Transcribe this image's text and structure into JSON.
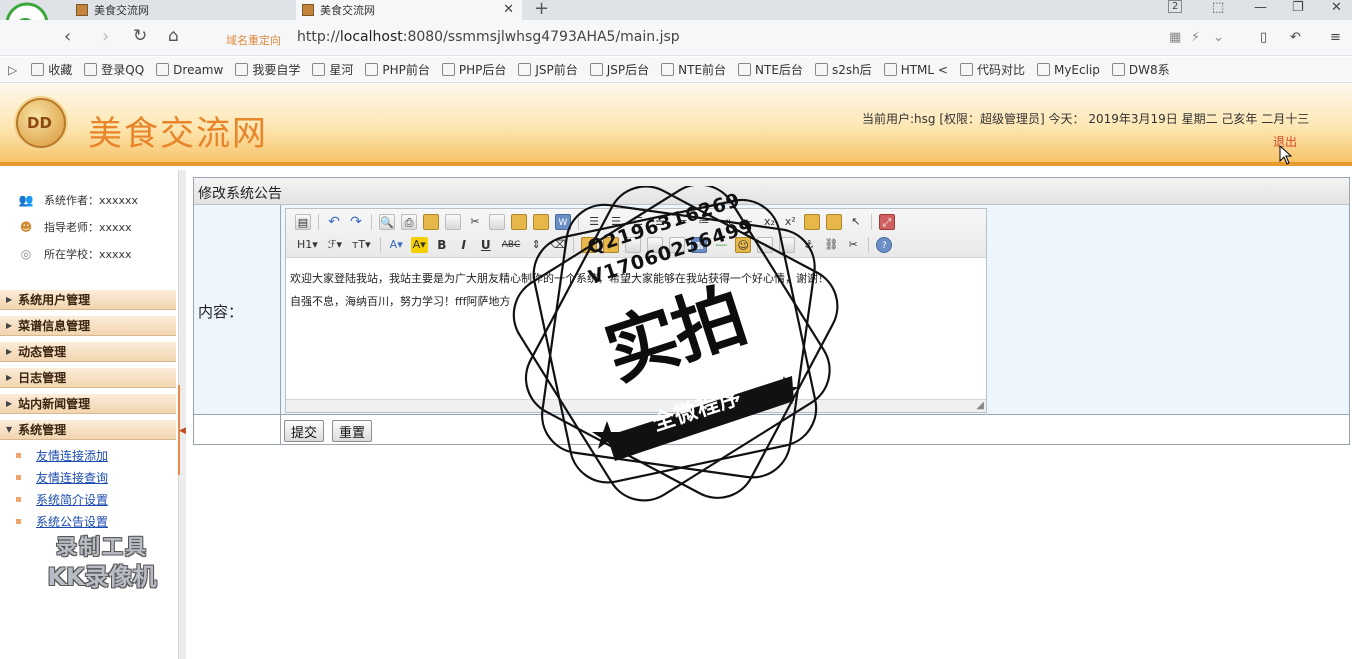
{
  "browser": {
    "tabs": [
      {
        "title": "美食交流网"
      },
      {
        "title": "美食交流网"
      }
    ],
    "tab_count": "2",
    "redirect_label": "域名重定向",
    "url_prefix": "http://",
    "url_host": "localhost",
    "url_rest": ":8080/ssmmsjlwhsg4793AHA5/main.jsp",
    "bookmarks": [
      {
        "label": "收藏",
        "icon": "star-icon"
      },
      {
        "label": "登录QQ",
        "icon": "qq-icon"
      },
      {
        "label": "Dreamw",
        "icon": "dreamweaver-icon"
      },
      {
        "label": "我要自学",
        "icon": "study-icon"
      },
      {
        "label": "星河",
        "icon": "page-icon"
      },
      {
        "label": "PHP前台",
        "icon": "page-icon"
      },
      {
        "label": "PHP后台",
        "icon": "page-icon"
      },
      {
        "label": "JSP前台",
        "icon": "page-icon"
      },
      {
        "label": "JSP后台",
        "icon": "page-icon"
      },
      {
        "label": "NTE前台",
        "icon": "page-icon"
      },
      {
        "label": "NTE后台",
        "icon": "page-icon"
      },
      {
        "label": "s2sh后",
        "icon": "image-icon"
      },
      {
        "label": "HTML <",
        "icon": "html-icon"
      },
      {
        "label": "代码对比",
        "icon": "compare-icon"
      },
      {
        "label": "MyEclip",
        "icon": "myeclipse-icon"
      },
      {
        "label": "DW8系",
        "icon": "paw-icon"
      }
    ]
  },
  "header": {
    "logo_text": "DD",
    "site_title": "美食交流网",
    "user_info": "当前用户:hsg [权限：超级管理员] 今天： 2019年3月19日 星期二 己亥年 二月十三",
    "logout_label": "退出"
  },
  "sidebar": {
    "info": [
      {
        "label": "系统作者：xxxxxx",
        "icon": "people-icon"
      },
      {
        "label": "指导老师：xxxxx",
        "icon": "teacher-icon"
      },
      {
        "label": "所在学校：xxxxx",
        "icon": "school-icon"
      }
    ],
    "menus": [
      {
        "label": "系统用户管理"
      },
      {
        "label": "菜谱信息管理"
      },
      {
        "label": "动态管理"
      },
      {
        "label": "日志管理"
      },
      {
        "label": "站内新闻管理"
      },
      {
        "label": "系统管理"
      }
    ],
    "submenu": [
      {
        "label": "友情连接添加"
      },
      {
        "label": "友情连接查询"
      },
      {
        "label": "系统简介设置"
      },
      {
        "label": "系统公告设置"
      }
    ],
    "watermark_line1": "录制工具",
    "watermark_line2": "KK录像机"
  },
  "main": {
    "panel_title": "修改系统公告",
    "content_label": "内容：",
    "editor_lines": [
      "欢迎大家登陆我站，我站主要是为广大朋友精心制作的一个系统，希望大家能够在我站获得一个好心情，谢谢！",
      "自强不息，海纳百川，努力学习！fff阿萨地方"
    ],
    "toolbar_row2": {
      "heading": "H1",
      "font": "ℱ",
      "size": "тT"
    },
    "submit_label": "提交",
    "reset_label": "重置"
  },
  "stamp": {
    "line1": "Q2196316269",
    "line2": "V17060256499",
    "big": "实拍",
    "banner": "全微程序"
  },
  "colors": {
    "accent": "#e8842a",
    "header_bottom": "#e79a2e",
    "link": "#1c4cb0"
  }
}
